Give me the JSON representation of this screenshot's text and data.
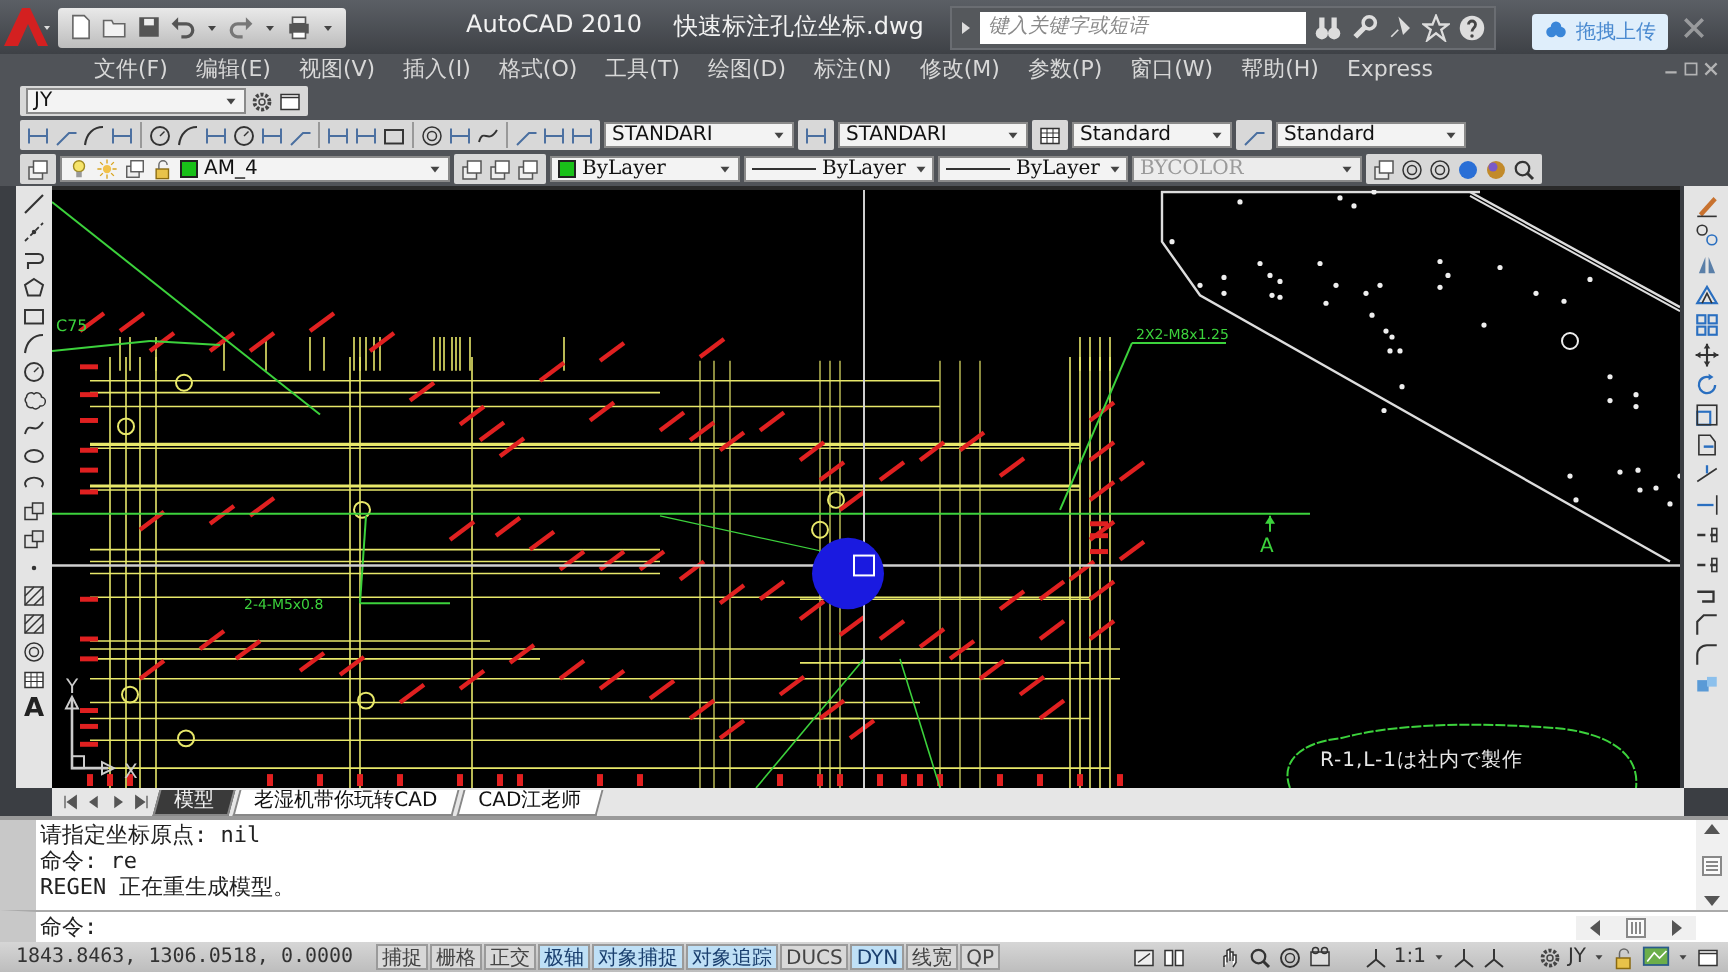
{
  "window": {
    "title": "AutoCAD 2010",
    "file_name": "快速标注孔位坐标.dwg"
  },
  "search": {
    "placeholder": "键入关键字或短语"
  },
  "upload_badge": {
    "label": "拖拽上传"
  },
  "menu": [
    "文件(F)",
    "编辑(E)",
    "视图(V)",
    "插入(I)",
    "格式(O)",
    "工具(T)",
    "绘图(D)",
    "标注(N)",
    "修改(M)",
    "参数(P)",
    "窗口(W)",
    "帮助(H)",
    "Express"
  ],
  "workspace": {
    "value": "JY"
  },
  "style_combos": [
    {
      "value": "STANDARI"
    },
    {
      "value": "STANDARI"
    },
    {
      "value": "Standard"
    },
    {
      "value": "Standard"
    }
  ],
  "property_combos": [
    {
      "kind": "layer",
      "value": "AM_4",
      "disabled": false
    },
    {
      "kind": "color",
      "value": "ByLayer",
      "disabled": false
    },
    {
      "kind": "linetype",
      "value": "ByLayer",
      "disabled": false
    },
    {
      "kind": "linetype",
      "value": "ByLayer",
      "disabled": false
    },
    {
      "kind": "plotstyle",
      "value": "BYCOLOR",
      "disabled": true
    }
  ],
  "draw_toolbar": {
    "text_tool": "A"
  },
  "drawing": {
    "labels": [
      "C75",
      "2X2-M8x1.25",
      "2-4-M5x0.8",
      "A",
      "R-1,L-1は社内で製作"
    ],
    "ucs": {
      "y_label": "Y",
      "x_label": "X"
    }
  },
  "layout_tabs": [
    {
      "label": "模型",
      "selected": true
    },
    {
      "label": "老湿机带你玩转CAD",
      "selected": false
    },
    {
      "label": "CAD江老师",
      "selected": false
    }
  ],
  "command_history": [
    "请指定坐标原点: nil",
    "命令: re",
    "REGEN 正在重生成模型。"
  ],
  "command_prompt": "命令:",
  "status_bar": {
    "coordinates": "1843.8463, 1306.0518, 0.0000",
    "toggles": [
      {
        "label": "捕捉",
        "on": false
      },
      {
        "label": "栅格",
        "on": false
      },
      {
        "label": "正交",
        "on": false
      },
      {
        "label": "极轴",
        "on": true
      },
      {
        "label": "对象捕捉",
        "on": true
      },
      {
        "label": "对象追踪",
        "on": true
      },
      {
        "label": "DUCS",
        "on": false
      },
      {
        "label": "DYN",
        "on": true
      },
      {
        "label": "线宽",
        "on": false
      },
      {
        "label": "QP",
        "on": false
      }
    ],
    "annotation_scale": "1:1",
    "workspace": "JY"
  }
}
